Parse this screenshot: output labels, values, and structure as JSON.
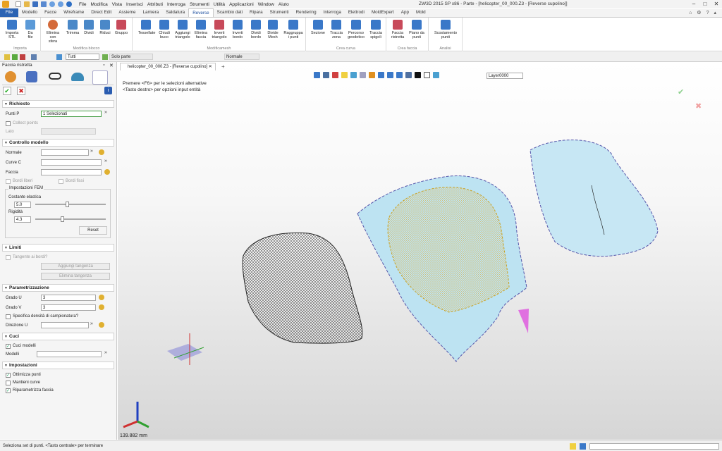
{
  "app": {
    "title": "ZW3D 2015 SP x86",
    "document_title": "Parte - [helicopter_00_000.Z3 - [Reverse cupolino]]"
  },
  "menu": [
    "File",
    "Modifica",
    "Vista",
    "Inserisci",
    "Attributi",
    "Interroga",
    "Strumenti",
    "Utilità",
    "Applicazioni",
    "Window",
    "Aiuto"
  ],
  "ribbon_tabs": [
    "File",
    "Modello",
    "Facce",
    "Wireframe",
    "Direct Edit",
    "Assieme",
    "Lamiera",
    "Saldatura",
    "Reverse",
    "Scambio dati",
    "Ripara",
    "Strumenti",
    "Rendering",
    "Interroga",
    "Elettrodi",
    "MoldExpert",
    "App",
    "Mold"
  ],
  "active_tab": "Reverse",
  "ribbon_groups": [
    {
      "label": "Importa",
      "buttons": [
        "Importa\nSTL",
        "Da\nfile"
      ]
    },
    {
      "label": "Modifica blocco",
      "buttons": [
        "Elimina\ncon sfera",
        "Trimma",
        "Dividi",
        "Riduci",
        "Gruppo"
      ]
    },
    {
      "label": "Modificamesh",
      "buttons": [
        "Tessellate",
        "Chiudi\nbuco",
        "Aggiungi\ntriangolo",
        "Elimina\nfaccia",
        "Inverti\ntriangolo",
        "Inverti\nbordo",
        "Dividi\nbordo",
        "Divide\nMesh",
        "Raggruppa\ni punti"
      ]
    },
    {
      "label": "Crea curva",
      "buttons": [
        "Sezione",
        "Traccia\nzona",
        "Percorso\ngeodetico",
        "Traccia\nspigoli"
      ]
    },
    {
      "label": "Crea faccia",
      "buttons": [
        "Faccia\nristretta",
        "Piano da\npunti"
      ]
    },
    {
      "label": "Analisi",
      "buttons": [
        "Scostamento\npunti"
      ]
    }
  ],
  "optbar": {
    "filter_value": "Tutti",
    "scope_value": "Solo parte",
    "view_value": "Normale"
  },
  "doc_tab": "helicopter_00_000.Z3 - [Reverse cupolino]",
  "viewport": {
    "prompt1": "Premere <F6> per le selezioni alternative",
    "prompt2": "<Tasto destro> per opzioni input entità",
    "layer": "Layer0000",
    "scale": "139.882 mm"
  },
  "panel": {
    "title": "Faccia ristretta",
    "richiesto": {
      "header": "Richiesto",
      "punti_label": "Punti P",
      "punti_value": "1 Selezionati",
      "collect": "Collect points",
      "lato": "Lato"
    },
    "controllo": {
      "header": "Controllo modello",
      "normale": "Normale",
      "curve_c": "Curve C",
      "faccia": "Faccia",
      "bordi_liberi": "Bordi liberi",
      "bordi_fissi": "Bordi fissi",
      "fem_title": "Impostazioni FEM",
      "costante": "Costante elastica",
      "costante_value": "5.0",
      "costante_level": 0.45,
      "rigidita": "Rigidità",
      "rigidita_value": "4.3",
      "rigidita_level": 0.38,
      "reset": "Reset"
    },
    "limiti": {
      "header": "Limiti",
      "tangente": "Tangente ai bordi?",
      "aggiungi": "Aggiungi tangenza",
      "elimina": "Elimina tangenza"
    },
    "param": {
      "header": "Parametrizzazione",
      "grado_u": "Grado U",
      "grado_u_value": "3",
      "grado_v": "Grado V",
      "grado_v_value": "3",
      "specifica": "Specifica densità di campionatura?",
      "direzione": "Direzione U"
    },
    "cuci": {
      "header": "Cuci",
      "cuci_modelli": "Cuci modelli",
      "modelli": "Modelli"
    },
    "impostazioni": {
      "header": "Impostazioni",
      "ottimizza": "Ottimizza punti",
      "mantieni": "Mantieni curve",
      "riparametrizza": "Riparametrizza faccia"
    }
  },
  "status": {
    "text": "Seleziona set di punti. <Tasto centrale> per terminare"
  }
}
